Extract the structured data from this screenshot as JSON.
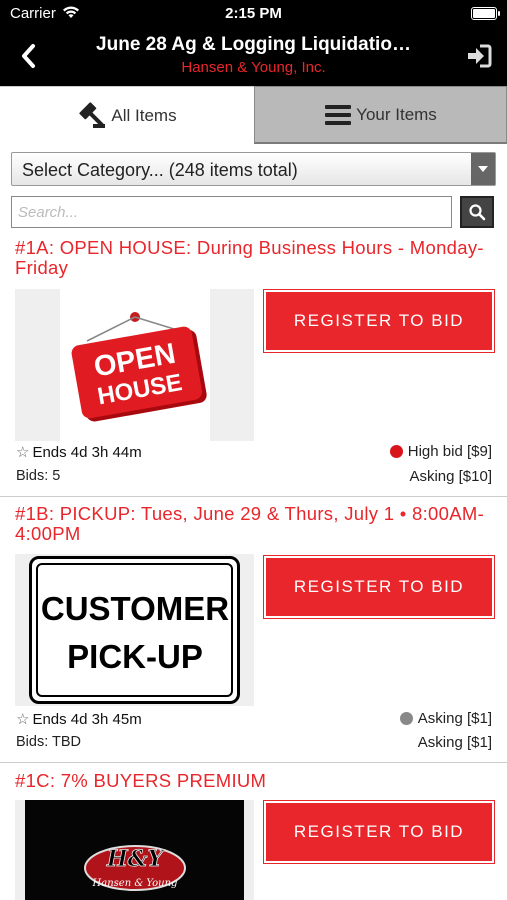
{
  "status_bar": {
    "carrier": "Carrier",
    "time": "2:15 PM"
  },
  "header": {
    "title": "June 28 Ag & Logging Liquidatio…",
    "subtitle": "Hansen & Young, Inc."
  },
  "tabs": [
    {
      "label": "All Items",
      "icon": "gavel-icon",
      "active": true
    },
    {
      "label": "Your Items",
      "icon": "list-icon",
      "active": false
    }
  ],
  "category_select": {
    "value": "Select Category... (248 items total)"
  },
  "search": {
    "placeholder": "Search..."
  },
  "items": [
    {
      "title": "#1A: OPEN HOUSE: During Business Hours - Monday-Friday",
      "image_text": [
        "OPEN",
        "HOUSE"
      ],
      "register_label": "REGISTER TO BID",
      "ends": "Ends 4d 3h 44m",
      "bids": "Bids: 5",
      "status_label": "High bid [$9]",
      "status_color": "#d9141a",
      "asking": "Asking [$10]"
    },
    {
      "title": "#1B: PICKUP: Tues, June 29 & Thurs, July 1 • 8:00AM-4:00PM",
      "image_text": [
        "CUSTOMER",
        "PICK-UP"
      ],
      "register_label": "REGISTER TO BID",
      "ends": "Ends 4d 3h 45m",
      "bids": "Bids: TBD",
      "status_label": "Asking [$1]",
      "status_color": "#888888",
      "asking": "Asking [$1]"
    },
    {
      "title": "#1C: 7% BUYERS PREMIUM",
      "image_text": [
        "H&Y",
        "Hansen & Young"
      ],
      "register_label": "REGISTER TO BID"
    }
  ],
  "colors": {
    "accent": "#e8262b",
    "header_bg": "#000000",
    "inactive_tab": "#b9b9b9"
  }
}
